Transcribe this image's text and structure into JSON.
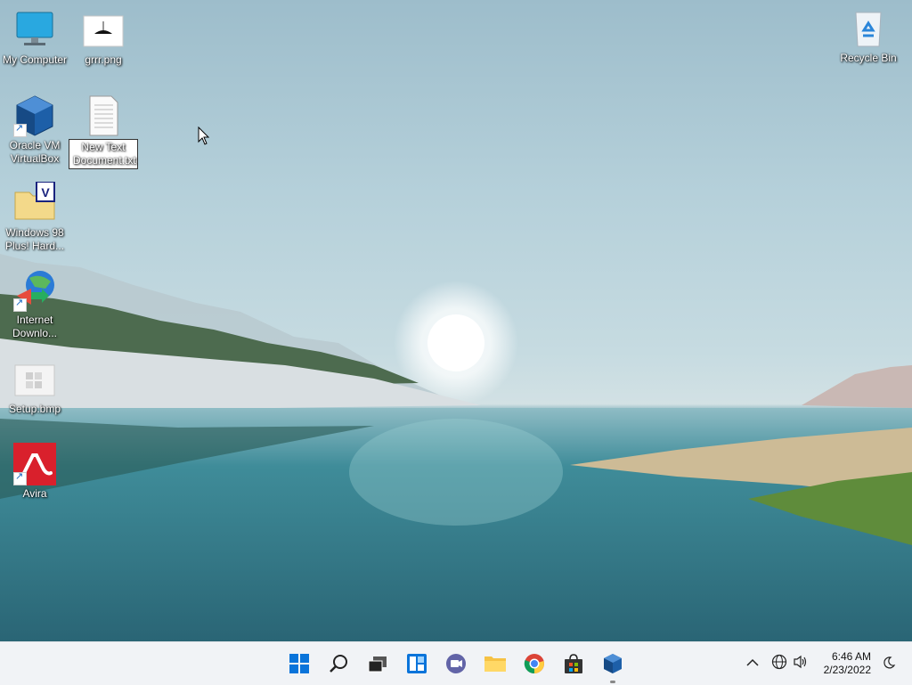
{
  "desktop": {
    "icons": [
      {
        "name": "my-computer",
        "label": "My Computer"
      },
      {
        "name": "grrr-png",
        "label": "grrr.png"
      },
      {
        "name": "oracle-vm-virtualbox",
        "label": "Oracle VM\nVirtualBox"
      },
      {
        "name": "new-text-document",
        "label": "New Text\nDocument.txt"
      },
      {
        "name": "windows-98-plus",
        "label": "Windows 98\nPlus! Hard..."
      },
      {
        "name": "internet-download",
        "label": "Internet\nDownlo..."
      },
      {
        "name": "setup-bmp",
        "label": "Setup.bmp"
      },
      {
        "name": "avira",
        "label": "Avira"
      },
      {
        "name": "recycle-bin",
        "label": "Recycle Bin"
      }
    ]
  },
  "taskbar": {
    "pinned": [
      "start-icon",
      "search-icon",
      "task-view-icon",
      "widgets-icon",
      "chat-icon",
      "file-explorer-icon",
      "chrome-icon",
      "store-icon",
      "virtualbox-icon"
    ],
    "tray": {
      "time": "6:46 AM",
      "date": "2/23/2022"
    }
  },
  "colors": {
    "taskbar_bg": "#f1f3f6",
    "accent": "#0067c0"
  }
}
